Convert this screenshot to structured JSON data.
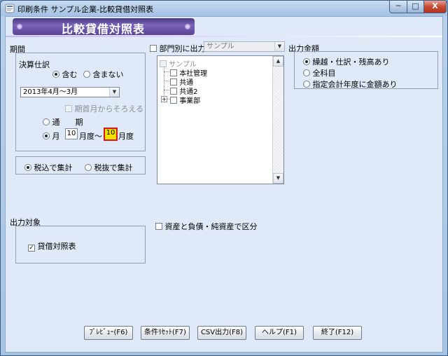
{
  "window": {
    "title": "印刷条件 サンプル企業-比較貸借対照表",
    "controls": {
      "minimize": "─",
      "maximize": "□",
      "close": "X"
    }
  },
  "header": {
    "title": "比較貸借対照表"
  },
  "period": {
    "label": "期間",
    "closing_entries_label": "決算仕訳",
    "include_label": "含む",
    "exclude_label": "含まない",
    "include_selected": true,
    "fiscal_year_value": "2013年4月～3月",
    "align_first_month_label": "期首月からそろえる",
    "full_period_label": "通　　期",
    "month_label": "月",
    "month_selected": true,
    "from_month": "10",
    "from_suffix": "月度",
    "range_sep": "～",
    "to_month": "10",
    "to_suffix": "月度"
  },
  "tax": {
    "tax_included_label": "税込で集計",
    "tax_excluded_label": "税抜で集計",
    "tax_included_selected": true
  },
  "department": {
    "checkbox_label": "部門別に出力",
    "combo_value": "サンプル",
    "tree": [
      {
        "label": "サンプル",
        "level": 0
      },
      {
        "label": "本社管理",
        "level": 1
      },
      {
        "label": "共通",
        "level": 1
      },
      {
        "label": "共通2",
        "level": 1
      },
      {
        "label": "事業部",
        "level": 1,
        "expander": "+"
      }
    ]
  },
  "output_amount": {
    "label": "出力金額",
    "options": [
      {
        "label": "繰越・仕訳・残高あり",
        "selected": true
      },
      {
        "label": "全科目",
        "selected": false
      },
      {
        "label": "指定会計年度に金額あり",
        "selected": false
      }
    ]
  },
  "split_option": {
    "label": "資産と負債・純資産で区分"
  },
  "output_target": {
    "label": "出力対象",
    "balance_sheet_label": "貸借対照表",
    "balance_sheet_checked": "✓"
  },
  "buttons": {
    "preview": "ﾌﾟﾚﾋﾞｭｰ(F6)",
    "reset": "条件ﾘｾｯﾄ(F7)",
    "csv": "CSV出力(F8)",
    "help": "ヘルプ(F1)",
    "exit": "終了(F12)"
  }
}
